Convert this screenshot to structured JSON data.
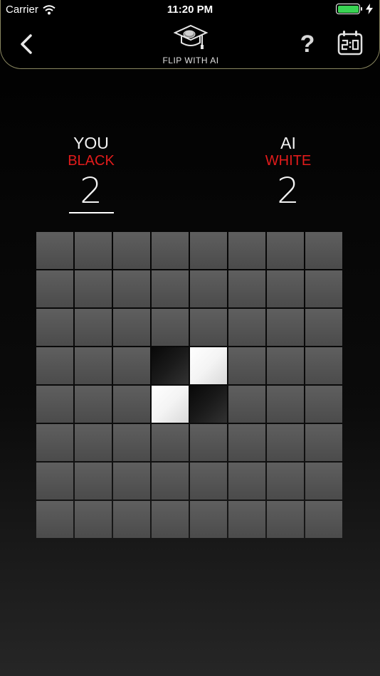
{
  "status": {
    "carrier": "Carrier",
    "time": "11:20 PM",
    "battery_color": "#39d353"
  },
  "nav": {
    "title": "FLIP WITH AI",
    "back_icon": "chevron-left-icon",
    "logo_icon": "graduation-cap-icon",
    "help_label": "?",
    "score_icon": "scoreboard-icon",
    "border_color": "#8a8760"
  },
  "players": {
    "you": {
      "name": "YOU",
      "color_label": "BLACK",
      "score": "2",
      "is_turn": true
    },
    "ai": {
      "name": "AI",
      "color_label": "WHITE",
      "score": "2",
      "is_turn": false
    },
    "label_color": "#e21b1b"
  },
  "board": {
    "size": 8,
    "cells": [
      [
        "",
        "",
        "",
        "",
        "",
        "",
        "",
        ""
      ],
      [
        "",
        "",
        "",
        "",
        "",
        "",
        "",
        ""
      ],
      [
        "",
        "",
        "",
        "",
        "",
        "",
        "",
        ""
      ],
      [
        "",
        "",
        "",
        "B",
        "W",
        "",
        "",
        ""
      ],
      [
        "",
        "",
        "",
        "W",
        "B",
        "",
        "",
        ""
      ],
      [
        "",
        "",
        "",
        "",
        "",
        "",
        "",
        ""
      ],
      [
        "",
        "",
        "",
        "",
        "",
        "",
        "",
        ""
      ],
      [
        "",
        "",
        "",
        "",
        "",
        "",
        "",
        ""
      ]
    ]
  }
}
